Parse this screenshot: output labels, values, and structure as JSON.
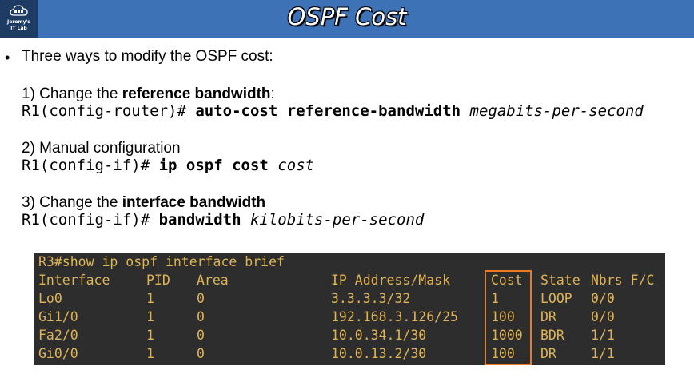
{
  "logo": {
    "line1": "Jeremy's",
    "line2": "IT Lab"
  },
  "slide": {
    "title": "OSPF Cost"
  },
  "intro": {
    "bullet": "•",
    "text": "Three ways to modify the OSPF cost:"
  },
  "methods": [
    {
      "label_prefix": "1) Change the ",
      "label_bold": "reference bandwidth",
      "label_suffix": ":",
      "cmd_prompt": "R1(config-router)# ",
      "cmd_keyword": "auto-cost reference-bandwidth ",
      "cmd_arg": "megabits-per-second"
    },
    {
      "label_prefix": "2) Manual configuration",
      "label_bold": "",
      "label_suffix": "",
      "cmd_prompt": "R1(config-if)# ",
      "cmd_keyword": "ip ospf cost ",
      "cmd_arg": "cost"
    },
    {
      "label_prefix": "3) Change the ",
      "label_bold": "interface bandwidth",
      "label_suffix": "",
      "cmd_prompt": "R1(config-if)# ",
      "cmd_keyword": "bandwidth ",
      "cmd_arg": "kilobits-per-second"
    }
  ],
  "terminal": {
    "command": "R3#show ip ospf interface brief",
    "columns": [
      "Interface",
      "PID",
      "Area",
      "IP Address/Mask",
      "Cost",
      "State",
      "Nbrs F/C"
    ],
    "rows": [
      [
        "Lo0",
        "1",
        "0",
        "3.3.3.3/32",
        "1",
        "LOOP",
        "0/0"
      ],
      [
        "Gi1/0",
        "1",
        "0",
        "192.168.3.126/25",
        "100",
        "DR",
        "0/0"
      ],
      [
        "Fa2/0",
        "1",
        "0",
        "10.0.34.1/30",
        "1000",
        "BDR",
        "1/1"
      ],
      [
        "Gi0/0",
        "1",
        "0",
        "10.0.13.2/30",
        "100",
        "DR",
        "1/1"
      ]
    ]
  },
  "colors": {
    "header": "#3e72b6",
    "logo_bg": "#1e3c63",
    "terminal_bg": "#2d2d2d",
    "terminal_text": "#e0b455",
    "highlight": "#ee7b24"
  }
}
